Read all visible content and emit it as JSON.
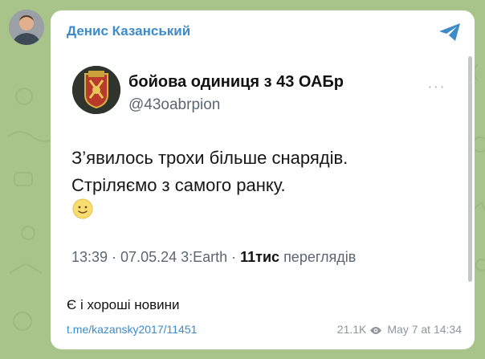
{
  "sender": {
    "name": "Денис Казанський"
  },
  "tweet": {
    "author": "бойова одиниця з 43 ОАБр",
    "handle": "@43oabrpion",
    "text_line1": "З’явилось трохи більше снарядів.",
    "text_line2": "Стріляємо з самого ранку.",
    "emoji": "slightly-smiling-face",
    "meta_prefix": "13:39 · 07.05.24 3:Earth · ",
    "views": "11тис",
    "views_label": " переглядів",
    "more_glyph": "···"
  },
  "message": {
    "caption": "Є і хороші новини",
    "link": "t.me/kazansky2017/11451",
    "view_count": "21.1K",
    "timestamp": "May 7 at 14:34"
  },
  "colors": {
    "accent": "#3d8bc9",
    "background": "#a9c48a",
    "bubble": "#ffffff"
  }
}
